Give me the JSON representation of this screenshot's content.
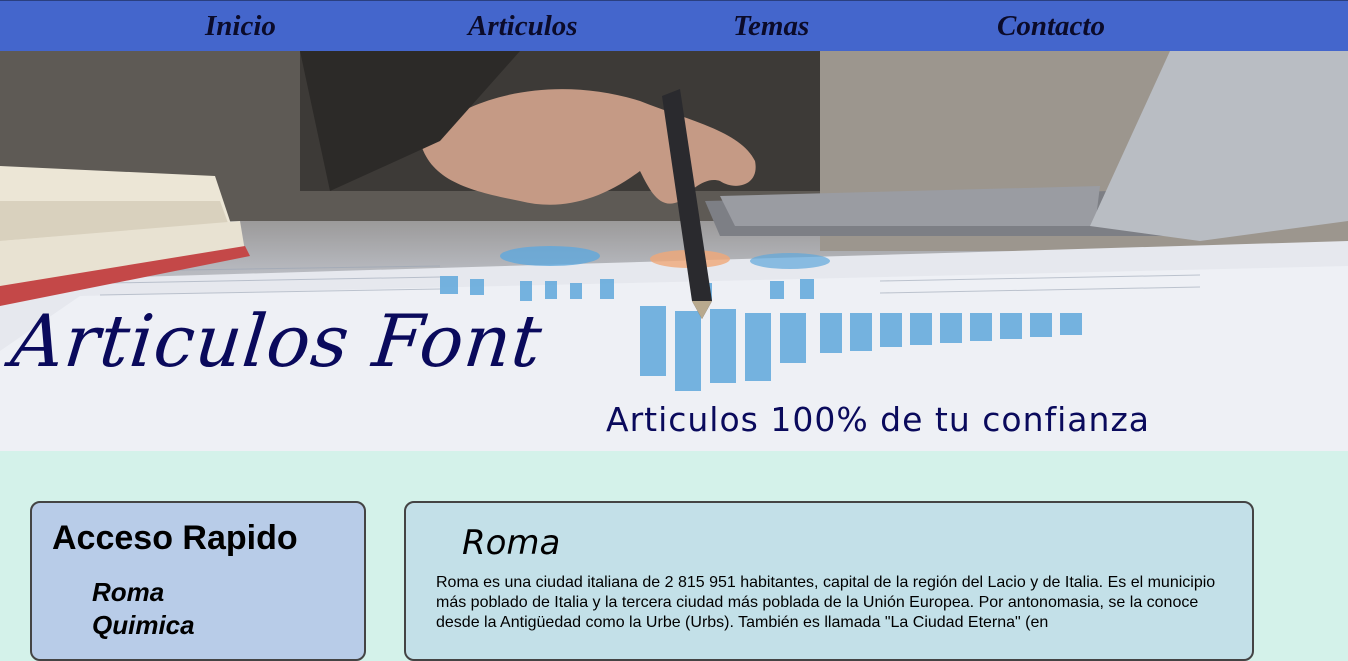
{
  "nav": {
    "items": [
      {
        "label": "Inicio"
      },
      {
        "label": "Articulos"
      },
      {
        "label": "Temas"
      },
      {
        "label": "Contacto"
      }
    ]
  },
  "hero": {
    "title": "Articulos Font",
    "subtitle": "Articulos 100% de tu confianza"
  },
  "sidebar": {
    "heading": "Acceso Rapido",
    "links": [
      "Roma",
      "Quimica"
    ]
  },
  "article": {
    "title": "Roma",
    "body": "Roma es una ciudad italiana de 2 815 951 habitantes, capital de la región del Lacio y de Italia. Es el municipio más poblado de Italia y la tercera ciudad más poblada de la Unión Europea. Por antonomasia, se la conoce desde la Antigüedad como la Urbe (Urbs). También es llamada \"La Ciudad Eterna\" (en"
  },
  "colors": {
    "nav_bg": "#4466cc",
    "page_bg": "#d4f2ea",
    "sidebar_bg": "#b8cce8",
    "article_bg": "#c3e0e8",
    "hero_text": "#0a0a5c"
  }
}
